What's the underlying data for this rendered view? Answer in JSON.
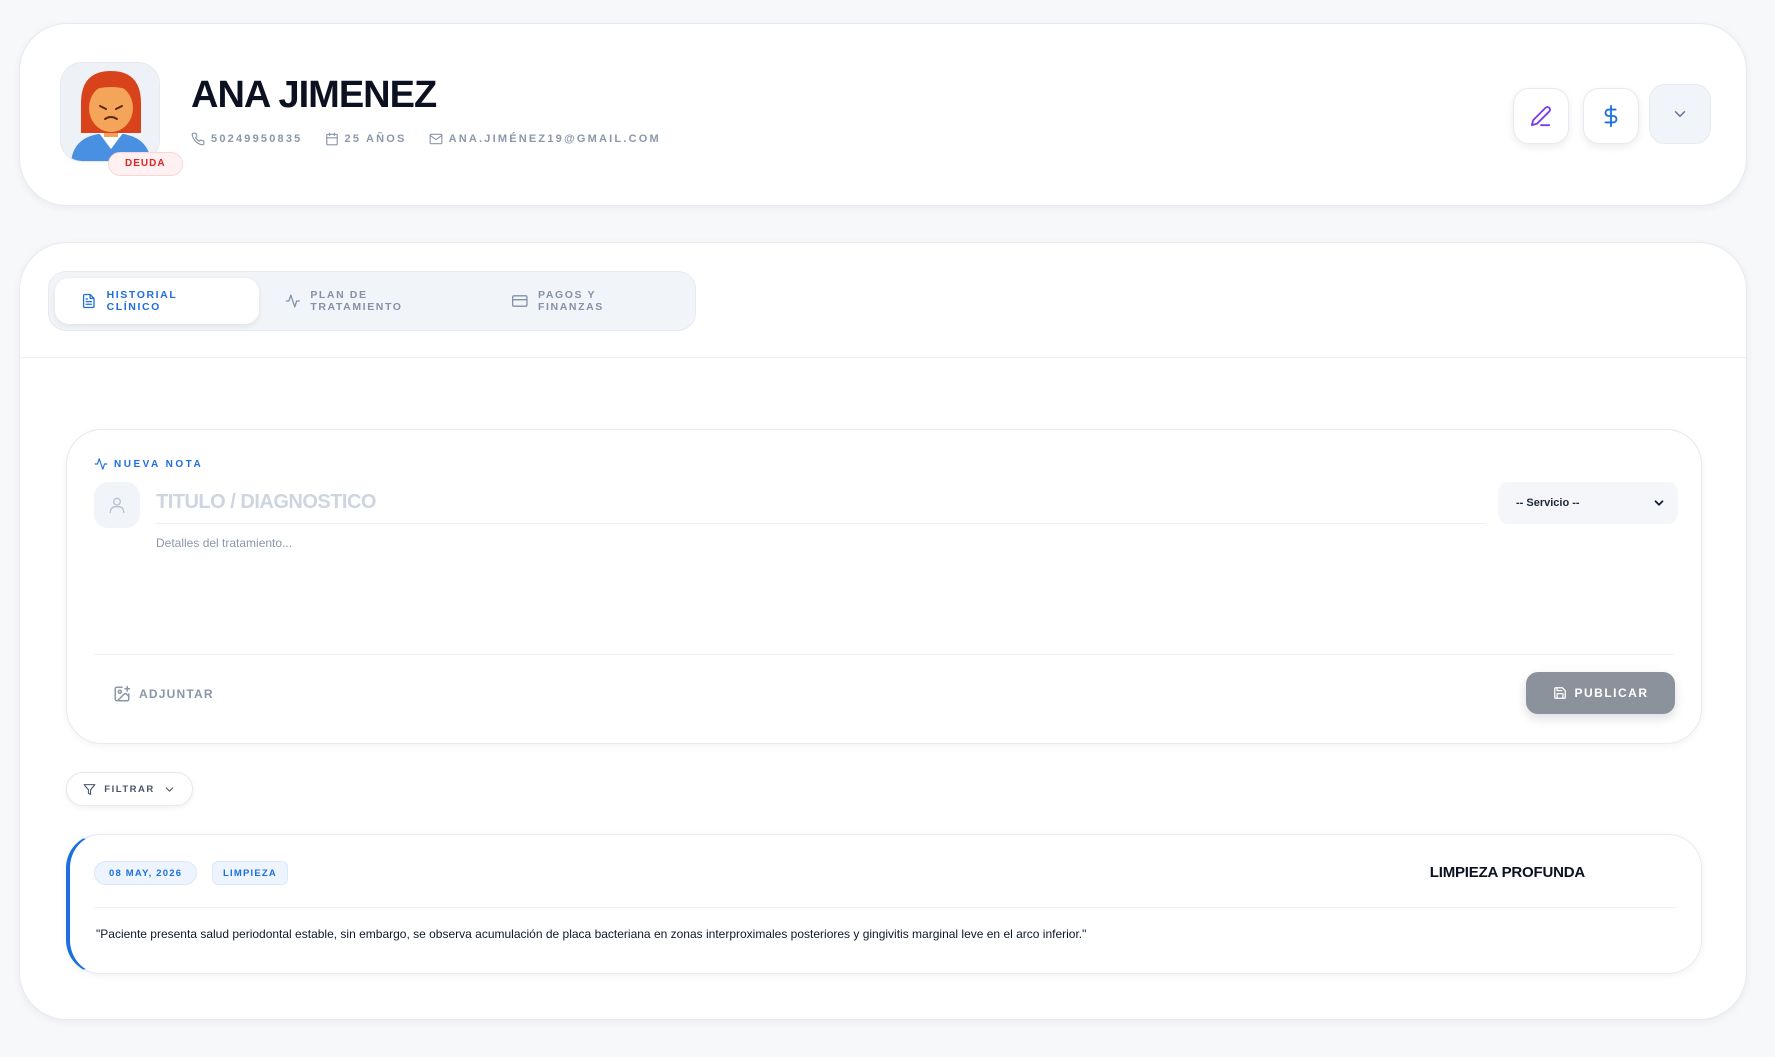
{
  "patient": {
    "name": "ANA JIMENEZ",
    "badge": "DEUDA",
    "phone": "50249950835",
    "age": "25 AÑOS",
    "email": "ANA.JIMÉNEZ19@GMAIL.COM"
  },
  "header_actions": {
    "edit_icon": "pencil-icon",
    "payment_icon": "dollar-icon",
    "more_icon": "chevron-down-icon"
  },
  "tabs": [
    {
      "label": "HISTORIAL CLÍNICO",
      "icon": "document-icon",
      "active": true
    },
    {
      "label": "PLAN DE TRATAMIENTO",
      "icon": "activity-icon",
      "active": false
    },
    {
      "label": "PAGOS Y FINANZAS",
      "icon": "credit-card-icon",
      "active": false
    }
  ],
  "note_form": {
    "label": "NUEVA NOTA",
    "title_placeholder": "TITULO / DIAGNOSTICO",
    "service_selected": "-- Servicio --",
    "details_placeholder": "Detalles del tratamiento...",
    "attach_label": "ADJUNTAR",
    "publish_label": "PUBLICAR"
  },
  "filter": {
    "label": "FILTRAR"
  },
  "records": [
    {
      "date": "08 MAY, 2026",
      "category": "LIMPIEZA",
      "title": "LIMPIEZA PROFUNDA",
      "text": "\"Paciente presenta salud periodontal estable, sin embargo, se observa acumulación de placa bacteriana en zonas interproximales posteriores y gingivitis marginal leve en el arco inferior.\""
    }
  ],
  "colors": {
    "accent": "#1d6fe0",
    "danger": "#dc2626",
    "publish_bg": "#8c929b",
    "edit_icon": "#7c3aed"
  }
}
